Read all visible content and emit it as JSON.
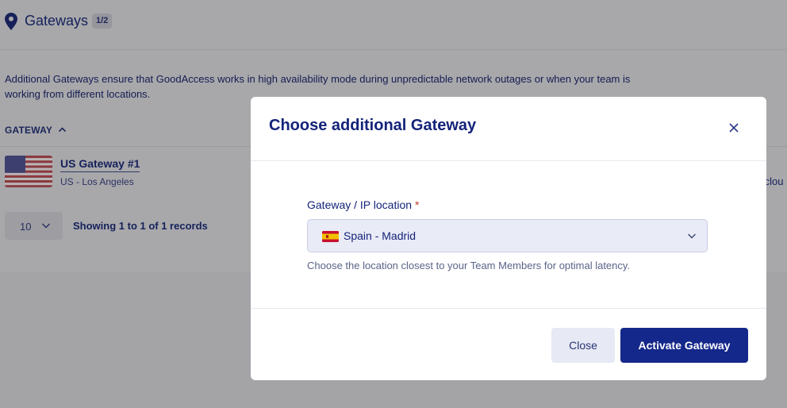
{
  "background": {
    "title": "Gateways",
    "count_badge": "1/2",
    "description": "Additional Gateways ensure that GoodAccess works in high availability mode during unpredictable network outages or when your team is working from different locations.",
    "table": {
      "column_header": "GATEWAY",
      "rows": [
        {
          "name": "US Gateway #1",
          "location": "US - Los Angeles",
          "extra": ".clou"
        }
      ]
    },
    "pagination": {
      "per_page": "10",
      "records_text": "Showing 1 to 1 of 1 records"
    }
  },
  "modal": {
    "title": "Choose additional Gateway",
    "field": {
      "label": "Gateway / IP location",
      "required_mark": "*",
      "selected_value": "Spain - Madrid",
      "help_text": "Choose the location closest to your Team Members for optimal latency."
    },
    "buttons": {
      "close": "Close",
      "activate": "Activate Gateway"
    }
  },
  "colors": {
    "primary": "#14278a",
    "overlay": "#a8a8ab",
    "select_bg": "#e9ebf6"
  },
  "icons": [
    "location-pin-icon",
    "sort-up-icon",
    "us-flag-icon",
    "chevron-down-icon",
    "close-icon",
    "spain-flag-icon"
  ]
}
